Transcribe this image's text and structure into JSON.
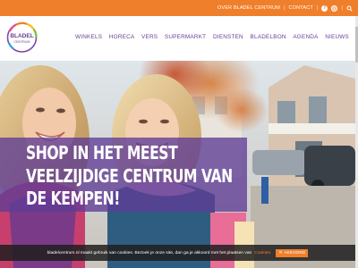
{
  "topbar": {
    "links": [
      "OVER BLADEL CENTRUM",
      "CONTACT"
    ],
    "separator": "|",
    "icons": [
      "facebook-icon",
      "instagram-icon",
      "search-icon"
    ],
    "color": "#f07f2b"
  },
  "logo": {
    "line1": "BLADEL",
    "line2": "CENTRUM"
  },
  "nav": {
    "items": [
      "WINKELS",
      "HORECA",
      "VERS",
      "SUPERMARKT",
      "DIENSTEN",
      "BLADELBON",
      "AGENDA",
      "NIEUWS"
    ],
    "color": "#6a3d96"
  },
  "hero": {
    "headline": [
      "SHOP IN HET MEEST",
      "VEELZIJDIGE CENTRUM VAN",
      "DE KEMPEN!"
    ],
    "overlay_color": "#5f3c96"
  },
  "cookie": {
    "text": "bladelcentrum.nl maakt gebruik van cookies. Bezoek je onze site, dan ga je akkoord met het plaatsen van",
    "link": "Cookies.",
    "button": "AKKOORD",
    "button_icon": "close-icon"
  }
}
